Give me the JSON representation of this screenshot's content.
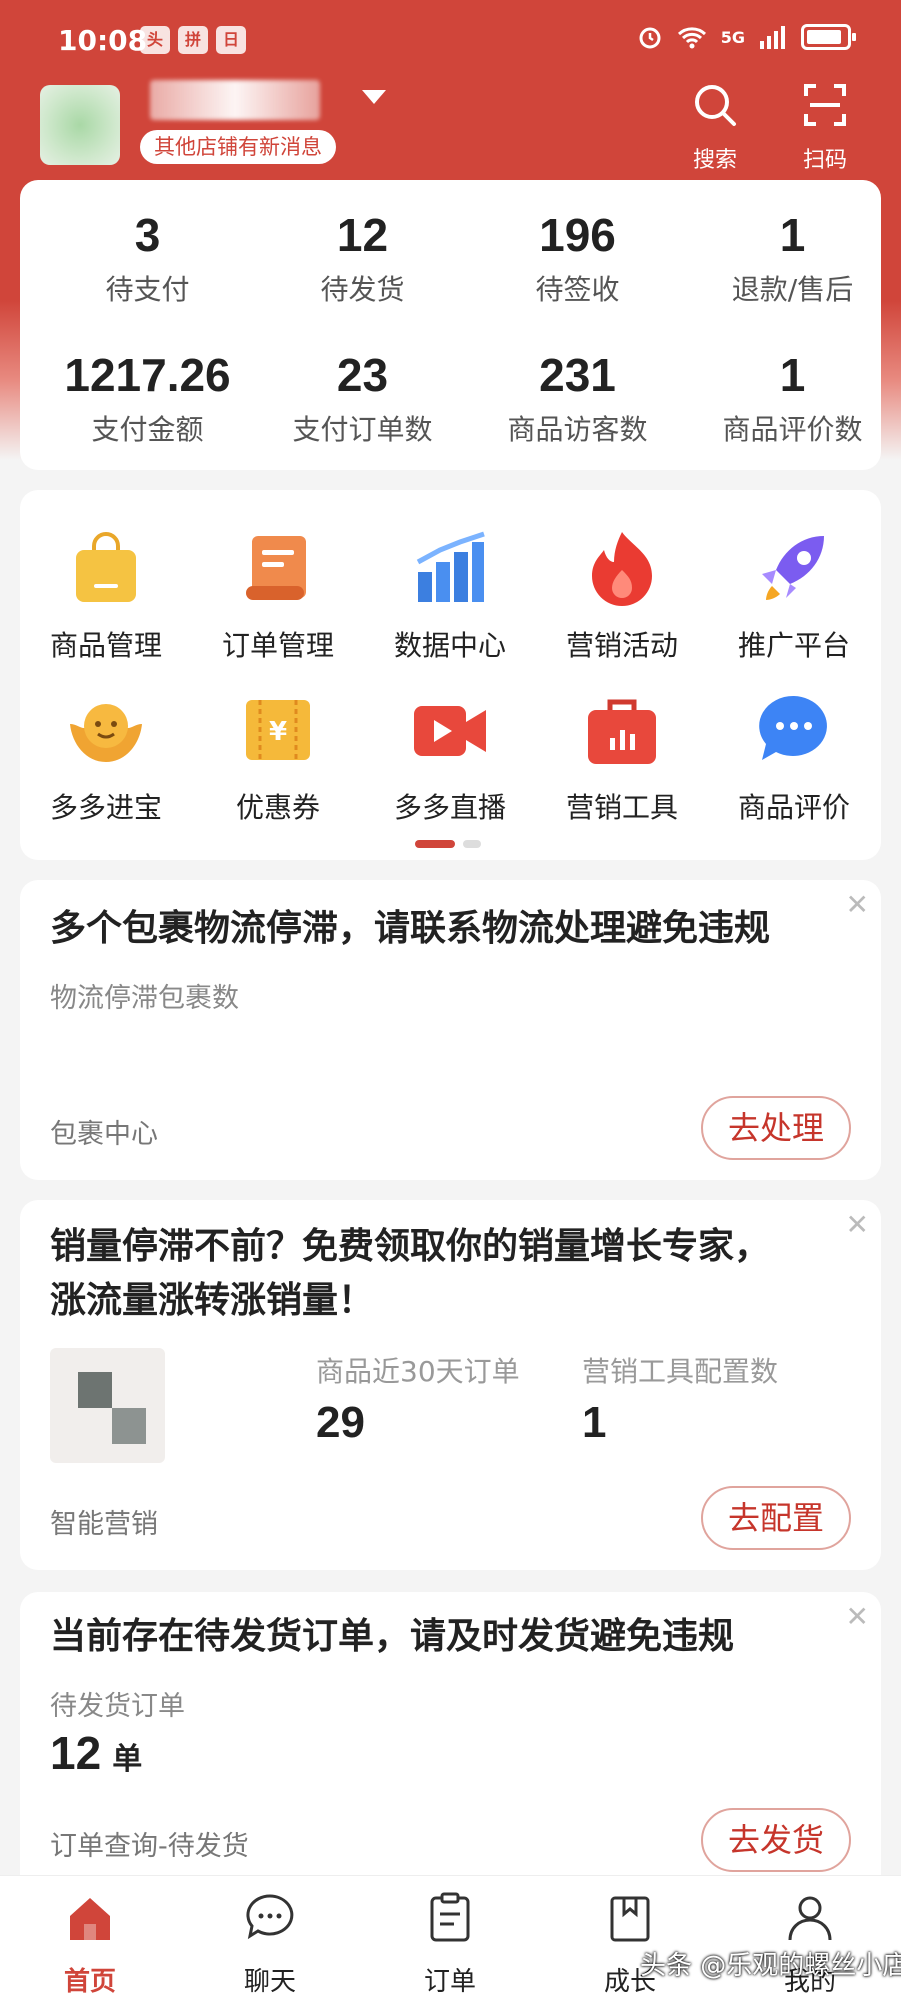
{
  "status_bar": {
    "time": "10:08",
    "network": "5G",
    "app_icons": [
      "头",
      "拼",
      "日"
    ]
  },
  "header": {
    "notice": "其他店铺有新消息",
    "search_label": "搜索",
    "scan_label": "扫码"
  },
  "stats": {
    "row1": [
      {
        "value": "3",
        "label": "待支付"
      },
      {
        "value": "12",
        "label": "待发货"
      },
      {
        "value": "196",
        "label": "待签收"
      },
      {
        "value": "1",
        "label": "退款/售后"
      }
    ],
    "row2": [
      {
        "value": "1217.26",
        "label": "支付金额"
      },
      {
        "value": "23",
        "label": "支付订单数"
      },
      {
        "value": "231",
        "label": "商品访客数"
      },
      {
        "value": "1",
        "label": "商品评价数"
      }
    ]
  },
  "grid": {
    "row1": [
      {
        "label": "商品管理",
        "icon": "bag-icon"
      },
      {
        "label": "订单管理",
        "icon": "scroll-icon"
      },
      {
        "label": "数据中心",
        "icon": "chart-icon"
      },
      {
        "label": "营销活动",
        "icon": "flame-icon"
      },
      {
        "label": "推广平台",
        "icon": "rocket-icon"
      }
    ],
    "row2": [
      {
        "label": "多多进宝",
        "icon": "ingot-icon"
      },
      {
        "label": "优惠券",
        "icon": "coupon-icon"
      },
      {
        "label": "多多直播",
        "icon": "video-icon"
      },
      {
        "label": "营销工具",
        "icon": "toolbox-icon"
      },
      {
        "label": "商品评价",
        "icon": "chat-icon"
      }
    ]
  },
  "task1": {
    "title": "多个包裹物流停滞，请联系物流处理避免违规",
    "sub": "物流停滞包裹数",
    "foot": "包裹中心",
    "button": "去处理"
  },
  "task2": {
    "title_line1": "销量停滞不前？免费领取你的销量增长专家，",
    "title_line2": "涨流量涨转涨销量！",
    "metric1_label": "商品近30天订单",
    "metric1_value": "29",
    "metric2_label": "营销工具配置数",
    "metric2_value": "1",
    "foot": "智能营销",
    "button": "去配置"
  },
  "task3": {
    "title": "当前存在待发货订单，请及时发货避免违规",
    "sub": "待发货订单",
    "count": "12",
    "unit": "单",
    "foot": "订单查询-待发货",
    "button": "去发货"
  },
  "bottom_nav": [
    {
      "label": "首页",
      "icon": "home-icon"
    },
    {
      "label": "聊天",
      "icon": "chat-bubble-icon"
    },
    {
      "label": "订单",
      "icon": "order-icon"
    },
    {
      "label": "成长",
      "icon": "book-icon"
    },
    {
      "label": "我的",
      "icon": "user-icon"
    }
  ],
  "watermark": "头条 @乐观的螺丝小店",
  "colors": {
    "accent": "#d0453a",
    "card": "#ffffff",
    "bg": "#f4f4f4"
  }
}
